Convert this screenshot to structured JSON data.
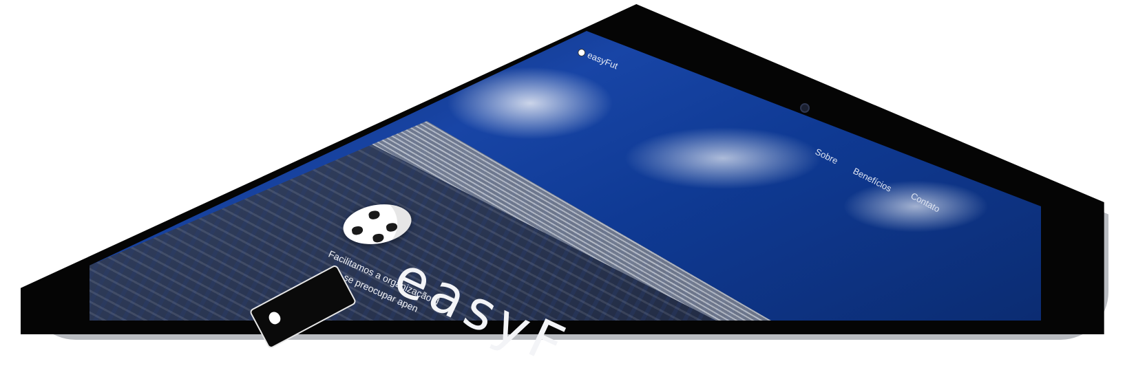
{
  "site": {
    "brand": "easyFut",
    "logo_text": "easyF",
    "nav": [
      "Sobre",
      "Benefícios",
      "Contato"
    ],
    "tagline_1": "Facilitamos a organização d",
    "tagline_2": "se preocupar apen"
  },
  "colors": {
    "sky": "#1845a6",
    "bezel": "#050505",
    "text": "#f0f2f7"
  },
  "icons": [
    "soccer-ball-icon",
    "apple-icon"
  ]
}
